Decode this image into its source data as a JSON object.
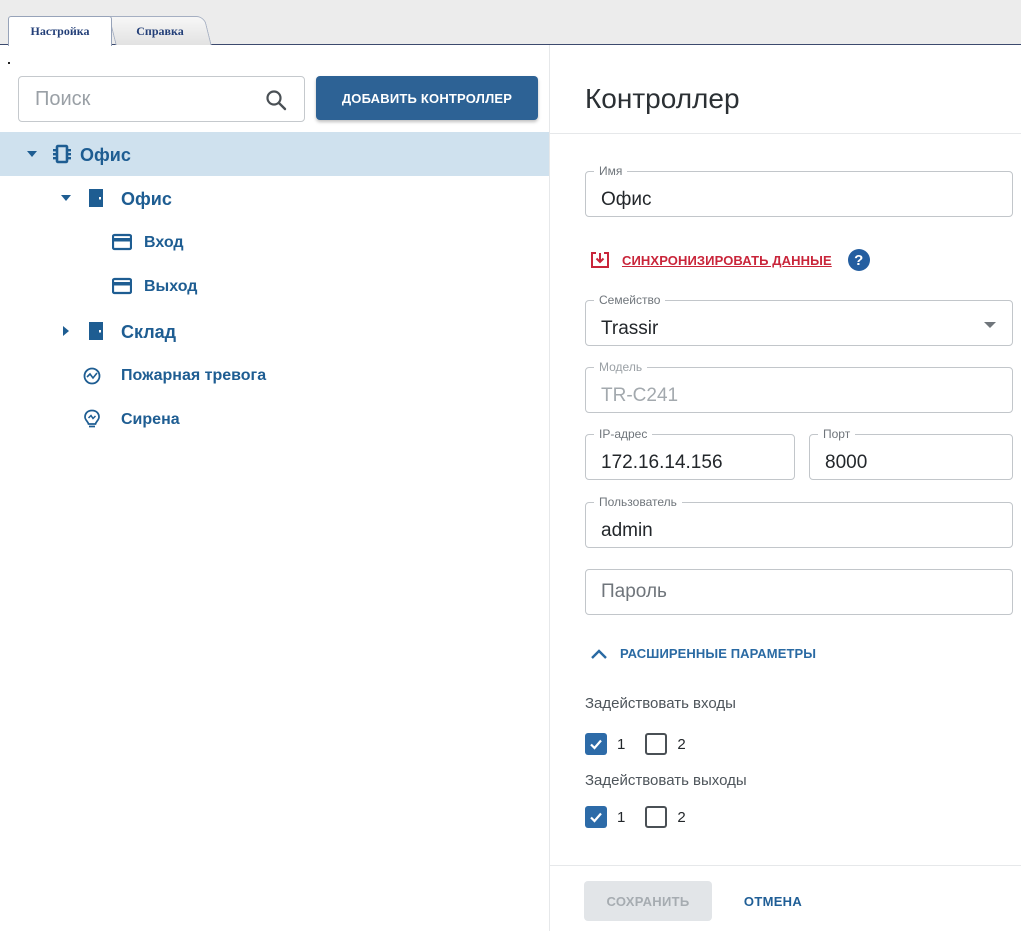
{
  "tabs": [
    {
      "label": "Настройка",
      "active": true
    },
    {
      "label": "Справка",
      "active": false
    }
  ],
  "left_panel": {
    "search": {
      "placeholder": "Поиск",
      "value": "",
      "icon": "search-icon"
    },
    "add_controller_label": "ДОБАВИТЬ КОНТРОЛЛЕР",
    "tree": [
      {
        "label": "Офис",
        "level": 0,
        "icon": "controller-icon",
        "expanded": true,
        "selected": true
      },
      {
        "label": "Офис",
        "level": 1,
        "icon": "door-icon",
        "expanded": true,
        "selected": false
      },
      {
        "label": "Вход",
        "level": 2,
        "icon": "reader-icon",
        "selected": false
      },
      {
        "label": "Выход",
        "level": 2,
        "icon": "reader-icon",
        "selected": false
      },
      {
        "label": "Склад",
        "level": 1,
        "icon": "door-icon",
        "expanded": false,
        "selected": false
      },
      {
        "label": "Пожарная тревога",
        "level": 1,
        "icon": "fire-alarm-icon",
        "selected": false
      },
      {
        "label": "Сирена",
        "level": 1,
        "icon": "siren-icon",
        "selected": false
      }
    ]
  },
  "right_panel": {
    "title": "Контроллер",
    "name_field": {
      "label": "Имя",
      "value": "Офис"
    },
    "sync_label": "СИНХРОНИЗИРОВАТЬ ДАННЫЕ",
    "help_glyph": "?",
    "family_field": {
      "label": "Семейство",
      "value": "Trassir"
    },
    "model_field": {
      "label": "Модель",
      "value": "TR-C241",
      "disabled": true
    },
    "ip_field": {
      "label": "IP-адрес",
      "value": "172.16.14.156"
    },
    "port_field": {
      "label": "Порт",
      "value": "8000"
    },
    "user_field": {
      "label": "Пользователь",
      "value": "admin"
    },
    "password_field": {
      "placeholder": "Пароль",
      "value": ""
    },
    "advanced_label": "РАСШИРЕННЫЕ ПАРАМЕТРЫ",
    "inputs_group": {
      "title": "Задействовать входы",
      "options": [
        {
          "label": "1",
          "checked": true
        },
        {
          "label": "2",
          "checked": false
        }
      ]
    },
    "outputs_group": {
      "title": "Задействовать выходы",
      "options": [
        {
          "label": "1",
          "checked": true
        },
        {
          "label": "2",
          "checked": false
        }
      ]
    },
    "save_label": "СОХРАНИТЬ",
    "cancel_label": "ОТМЕНА"
  },
  "colors": {
    "primary": "#2d6295",
    "link": "#1e5d92",
    "accent_red": "#c9253a",
    "selected_row": "#cfe1ee",
    "checkbox_on": "#2d6ba8"
  }
}
